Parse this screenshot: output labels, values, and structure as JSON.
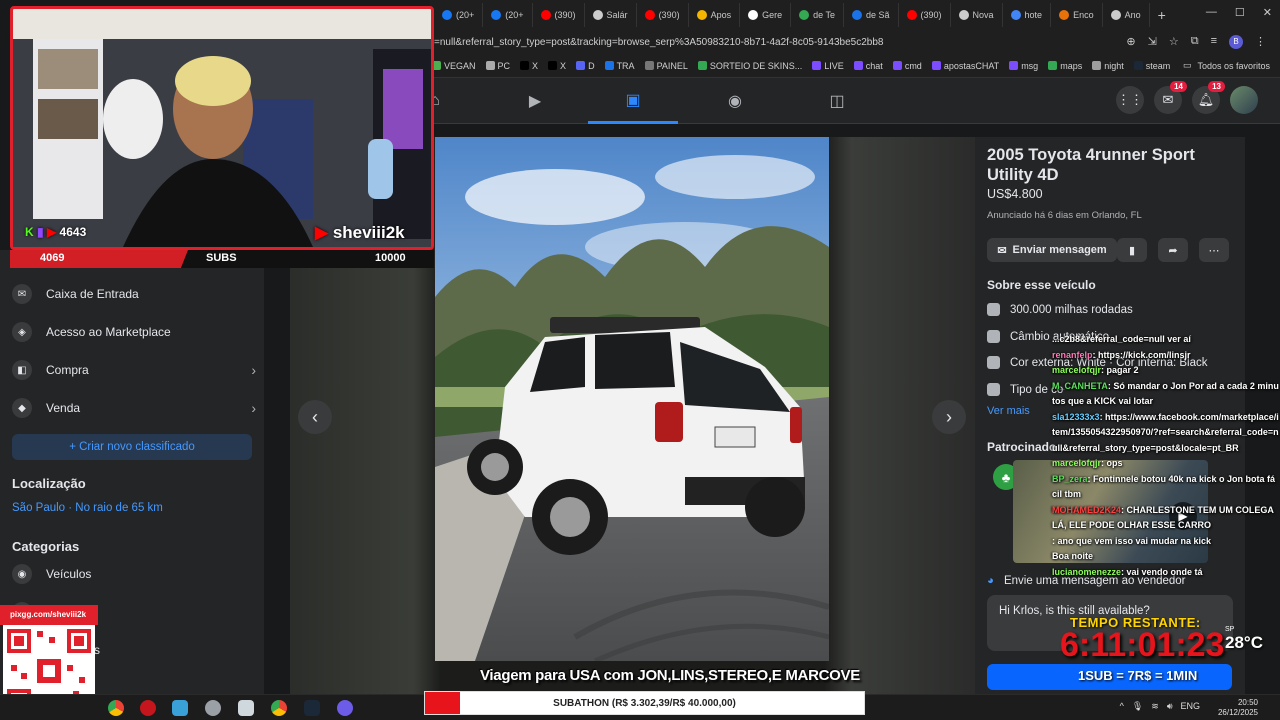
{
  "browser": {
    "tabs": [
      {
        "label": "(20+",
        "color": "#1877f2"
      },
      {
        "label": "(20+",
        "color": "#1877f2"
      },
      {
        "label": "(390)",
        "color": "#ff0000"
      },
      {
        "label": "Salár",
        "color": "#cccccc"
      },
      {
        "label": "(390)",
        "color": "#ff0000"
      },
      {
        "label": "Apos",
        "color": "#f4b400"
      },
      {
        "label": "Gere",
        "color": "#ffffff"
      },
      {
        "label": "de Te",
        "color": "#34a853"
      },
      {
        "label": "de Sã",
        "color": "#1a73e8"
      },
      {
        "label": "(390)",
        "color": "#ff0000"
      },
      {
        "label": "Nova",
        "color": "#cccccc"
      },
      {
        "label": "hote",
        "color": "#4285f4"
      },
      {
        "label": "Enco",
        "color": "#e8710a"
      },
      {
        "label": "Ano",
        "color": "#cccccc"
      }
    ],
    "new_tab": "+",
    "url": "=null&referral_story_type=post&tracking=browse_serp%3A50983210-8b71-4a2f-8c05-9143be5c2bb8",
    "bookmarks": [
      {
        "label": "VEGAN",
        "color": "#4caf50"
      },
      {
        "label": "PC",
        "color": "#aaaaaa"
      },
      {
        "label": "X",
        "color": "#000000"
      },
      {
        "label": "X",
        "color": "#000000"
      },
      {
        "label": "D",
        "color": "#5865f2"
      },
      {
        "label": "TRA",
        "color": "#1a73e8"
      },
      {
        "label": "PAINEL",
        "color": "#777777"
      },
      {
        "label": "SORTEIO DE SKINS...",
        "color": "#34a853"
      },
      {
        "label": "LIVE",
        "color": "#7c4dff"
      },
      {
        "label": "chat",
        "color": "#7c4dff"
      },
      {
        "label": "cmd",
        "color": "#7c4dff"
      },
      {
        "label": "apostasCHAT",
        "color": "#7c4dff"
      },
      {
        "label": "msg",
        "color": "#7c4dff"
      },
      {
        "label": "maps",
        "color": "#34a853"
      },
      {
        "label": "night",
        "color": "#9e9e9e"
      },
      {
        "label": "steam",
        "color": "#1b2838"
      }
    ],
    "all_favorites": "Todos os favoritos"
  },
  "fb": {
    "notif_msgs": "14",
    "notif_bell": "13"
  },
  "stream": {
    "kick_viewers": "4643",
    "yt_name": "sheviii2k",
    "count_left": "4069",
    "subs_label": "SUBS",
    "subs_goal": "10000",
    "qr_label": "pixgg.com/sheviii2k",
    "trip_text": "Viagem para USA com JON,LINS,STEREO,E MARCOVE",
    "timer_label": "TEMPO RESTANTE:",
    "timer_value": "6:11:01:23",
    "temp_city": "SP",
    "temperature": "28°C",
    "sub_rate": "1SUB = 7R$ = 1MIN",
    "subathon": "SUBATHON (R$ 3.302,39/R$ 40.000,00)"
  },
  "sidebar": {
    "items": [
      {
        "label": "Caixa de Entrada",
        "icon": "inbox-icon",
        "chevron": false
      },
      {
        "label": "Acesso ao Marketplace",
        "icon": "shield-icon",
        "chevron": false
      },
      {
        "label": "Compra",
        "icon": "bag-icon",
        "chevron": true
      },
      {
        "label": "Venda",
        "icon": "tag-icon",
        "chevron": true
      }
    ],
    "new_listing": "+ Criar novo classificado",
    "location_heading": "Localização",
    "location_value": "São Paulo · No raio de 65 km",
    "categories_heading": "Categorias",
    "categories": [
      {
        "label": "Veículos"
      },
      {
        "label": "e imóveis"
      },
      {
        "label": "omésticos"
      },
      {
        "label": "portivos"
      }
    ]
  },
  "listing": {
    "title": "2005 Toyota 4runner Sport Utility 4D",
    "price": "US$4.800",
    "meta": "Anunciado há 6 dias em Orlando, FL",
    "send_message": "Enviar mensagem",
    "about_heading": "Sobre esse veículo",
    "details": [
      {
        "label": "300.000 milhas rodadas",
        "icon": "speedometer-icon"
      },
      {
        "label": "Câmbio automático",
        "icon": "transmission-icon"
      },
      {
        "label": "Cor externa: White · Cor interna: Black",
        "icon": "paint-icon"
      },
      {
        "label": "Tipo de co",
        "icon": "fuel-icon"
      }
    ],
    "see_more": "Ver mais",
    "sponsored_heading": "Patrocinado",
    "send_seller_heading": "Envie uma mensagem ao vendedor",
    "message_text": "Hi Krlos, is this still available?"
  },
  "chat": [
    {
      "user": "",
      "color": "#ffffff",
      "text": "...c2b8&referral_code=null ver aí"
    },
    {
      "user": "renanfelp",
      "color": "#ff7ab8",
      "text": ": https://kick.com/linsjr"
    },
    {
      "user": "marcelofqjr",
      "color": "#8cff5a",
      "text": ": pagar 2"
    },
    {
      "user": "M_CANHETA",
      "color": "#5ae05a",
      "text": ": Só mandar o Jon Por ad a cada 2 minutos que a KICK vai lotar"
    },
    {
      "user": "sla12333x3",
      "color": "#66ccff",
      "text": ": https://www.facebook.com/marketplace/item/1355054322950970/?ref=search&referral_code=null&referral_story_type=post&locale=pt_BR"
    },
    {
      "user": "marcelofqjr",
      "color": "#8cff5a",
      "text": ": ops"
    },
    {
      "user": "BP_zera",
      "color": "#5ae05a",
      "text": ": Fontinnele botou 40k na kick o Jon bota fácil tbm"
    },
    {
      "user": "MOHAMED2K24",
      "color": "#ff4040",
      "text": ": CHARLESTONE TEM UM COLEGA LÁ, ELE PODE OLHAR ESSE CARRO"
    },
    {
      "user": "",
      "color": "#ffffff",
      "text": ": ano que vem isso vai mudar na kick"
    },
    {
      "user": "",
      "color": "#ffffff",
      "text": "Boa noite"
    },
    {
      "user": "lucianomenezze",
      "color": "#8cff5a",
      "text": ": vai vendo onde tá"
    }
  ],
  "taskbar": {
    "time": "20:50",
    "date": "26/12/2025",
    "lang": "ENG"
  }
}
